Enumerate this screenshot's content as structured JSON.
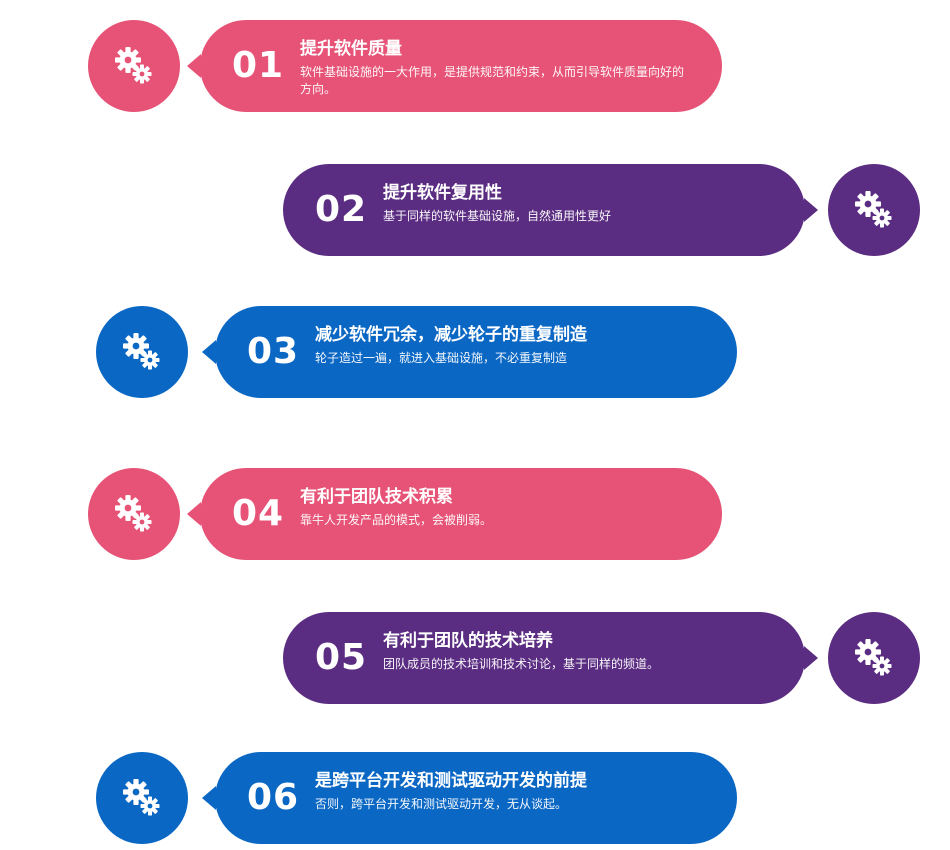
{
  "items": [
    {
      "number": "01",
      "title": "提升软件质量",
      "desc": "软件基础设施的一大作用，是提供规范和约束，从而引导软件质量向好的方向。",
      "color": "#e65376",
      "icon": "gears-icon"
    },
    {
      "number": "02",
      "title": "提升软件复用性",
      "desc": "基于同样的软件基础设施，自然通用性更好",
      "color": "#5b2d82",
      "icon": "gears-icon"
    },
    {
      "number": "03",
      "title": "减少软件冗余，减少轮子的重复制造",
      "desc": "轮子造过一遍，就进入基础设施，不必重复制造",
      "color": "#0a67c4",
      "icon": "gears-icon"
    },
    {
      "number": "04",
      "title": "有利于团队技术积累",
      "desc": "靠牛人开发产品的模式，会被削弱。",
      "color": "#e65376",
      "icon": "gears-icon"
    },
    {
      "number": "05",
      "title": "有利于团队的技术培养",
      "desc": "团队成员的技术培训和技术讨论，基于同样的频道。",
      "color": "#5b2d82",
      "icon": "gears-icon"
    },
    {
      "number": "06",
      "title": "是跨平台开发和测试驱动开发的前提",
      "desc": "否则，跨平台开发和测试驱动开发，无从谈起。",
      "color": "#0a67c4",
      "icon": "gears-icon"
    }
  ]
}
